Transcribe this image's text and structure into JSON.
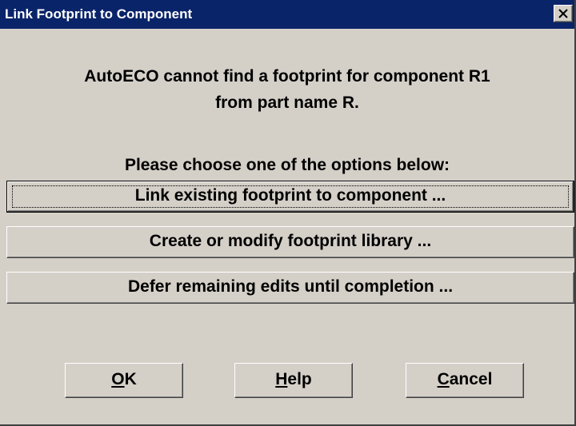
{
  "window": {
    "title": "Link Footprint to Component",
    "close_label": "close"
  },
  "message": {
    "line1": "AutoECO cannot find a footprint for component R1",
    "line2": "from part name R.",
    "prompt": "Please choose one of the options below:"
  },
  "options": {
    "link_existing": "Link existing footprint to component ...",
    "create_modify": "Create or modify footprint library ...",
    "defer": "Defer remaining edits until completion ..."
  },
  "buttons": {
    "ok": {
      "accel": "O",
      "rest": "K"
    },
    "help": {
      "accel": "H",
      "rest": "elp"
    },
    "cancel": {
      "accel": "C",
      "rest": "ancel"
    }
  },
  "icons": {
    "close": "close-icon"
  },
  "colors": {
    "titlebar": "#0a246a",
    "dialog_bg": "#d4d0c8",
    "text": "#000000"
  }
}
